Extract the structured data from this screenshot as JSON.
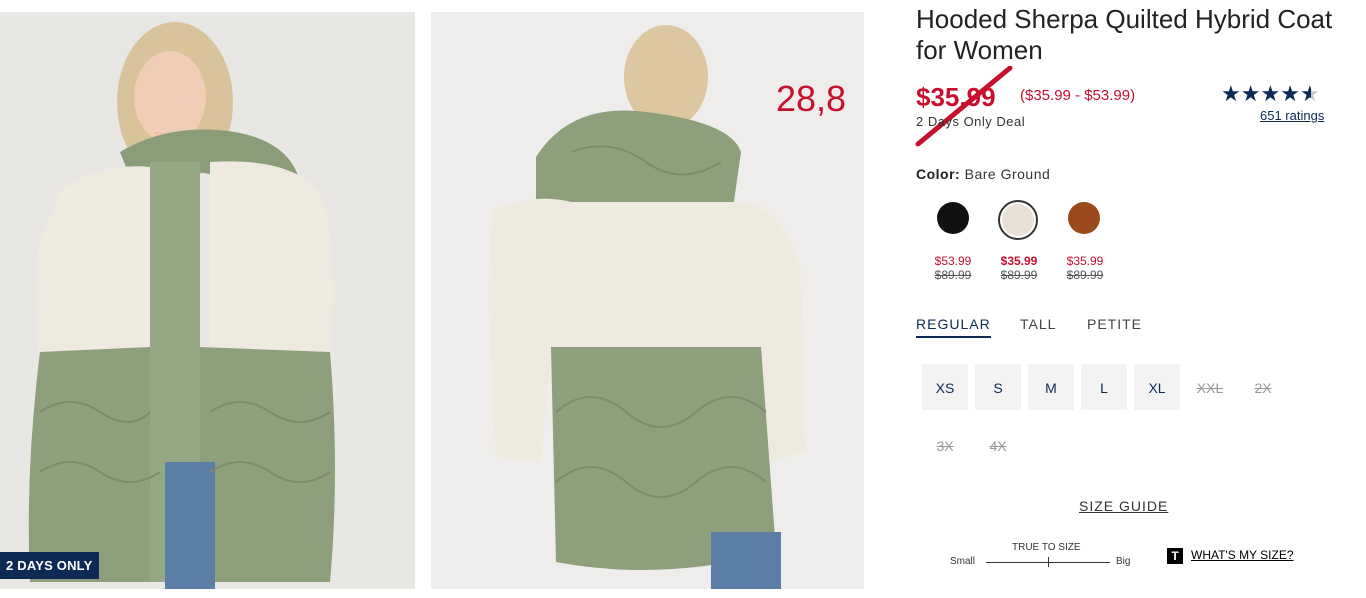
{
  "gallery": {
    "badge": "2 DAYS ONLY",
    "overlay_number": "28,8"
  },
  "product": {
    "title": "Hooded Sherpa Quilted Hybrid Coat for Women",
    "price": "$35.99",
    "price_range": "($35.99 - $53.99)",
    "deal": "2 Days Only Deal",
    "rating_stars": "★★★★★",
    "rating_value": 4.5,
    "ratings_count": "651 ratings"
  },
  "colors": {
    "label": "Color:",
    "selected": "Bare Ground",
    "swatches": [
      {
        "name": "Black",
        "hex": "#111111",
        "price": "$53.99",
        "old_price": "$89.99"
      },
      {
        "name": "Bare Ground",
        "hex": "#e8e2d6",
        "price": "$35.99",
        "old_price": "$89.99"
      },
      {
        "name": "Brown",
        "hex": "#9a4a1c",
        "price": "$35.99",
        "old_price": "$89.99"
      }
    ]
  },
  "fit_tabs": [
    "REGULAR",
    "TALL",
    "PETITE"
  ],
  "sizes": {
    "available": [
      "XS",
      "S",
      "M",
      "L",
      "XL"
    ],
    "unavailable": [
      "XXL",
      "2X",
      "3X",
      "4X"
    ]
  },
  "size_guide": "SIZE GUIDE",
  "fit_scale": {
    "title": "TRUE TO SIZE",
    "min_label": "Small",
    "max_label": "Big"
  },
  "whats_my_size": {
    "icon": "T",
    "label": "WHAT'S MY SIZE?"
  },
  "theme": {
    "accent_red": "#c8102e",
    "navy": "#0d2a54"
  }
}
